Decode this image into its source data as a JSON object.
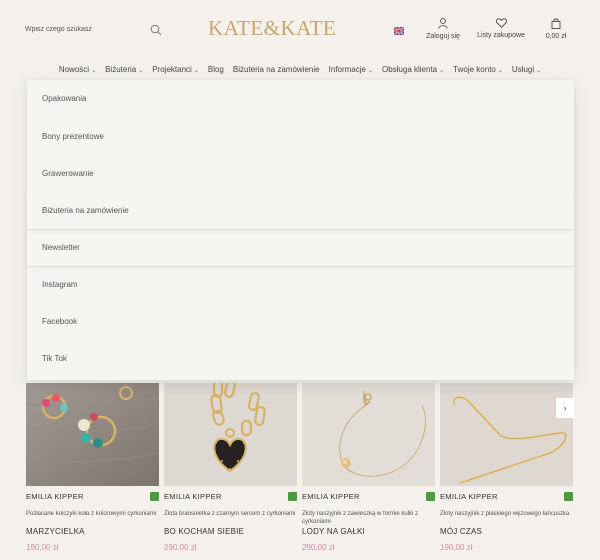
{
  "search": {
    "placeholder": "Wpisz czego szukasz"
  },
  "logo": {
    "text": "KATE&KATE"
  },
  "header": {
    "login_label": "Zaloguj się",
    "wishlist_label": "Listy zakupowe",
    "cart_label": "0,00 zł"
  },
  "nav": {
    "items": [
      {
        "label": "Nowości",
        "has_dropdown": true
      },
      {
        "label": "Biżuteria",
        "has_dropdown": true
      },
      {
        "label": "Projektanci",
        "has_dropdown": true
      },
      {
        "label": "Blog",
        "has_dropdown": false
      },
      {
        "label": "Biżuteria na zamówienie",
        "has_dropdown": false
      },
      {
        "label": "Informacje",
        "has_dropdown": true
      },
      {
        "label": "Obsługa klienta",
        "has_dropdown": true
      },
      {
        "label": "Twoje konto",
        "has_dropdown": true
      },
      {
        "label": "Usługi",
        "has_dropdown": true
      }
    ]
  },
  "dropdown": {
    "items": [
      "Opakowania",
      "Bony prezentowe",
      "Grawerowanie",
      "Biżuteria na zamówienie",
      "Newsletter",
      "Instagram",
      "Facebook",
      "Tik Tok"
    ]
  },
  "products": [
    {
      "brand": "EMILIA KIPPER",
      "desc": "Pozłacane kolczyki koła z kolorowymi cyrkoniami",
      "name": "MARZYCIELKA",
      "price": "190,00 zł"
    },
    {
      "brand": "EMILIA KIPPER",
      "desc": "Złota bransoletka z czarnym sercem z cyrkoniami",
      "name": "BO KOCHAM SIEBIE",
      "price": "290,00 zł"
    },
    {
      "brand": "EMILIA KIPPER",
      "desc": "Złoty naszyjnik z zawieszką w formie kulki z cyrkoniami",
      "name": "LODY NA GAŁKI",
      "price": "290,00 zł"
    },
    {
      "brand": "EMILIA KIPPER",
      "desc": "Złoty naszyjnik z płaskiego wężowego łańcuszka",
      "name": "MÓJ CZAS",
      "price": "190,00 zł"
    }
  ],
  "carousel": {
    "next_glyph": "›"
  },
  "colors": {
    "accent_logo": "#c8a56a",
    "price": "#d28aa5",
    "badge": "#4a9c3d",
    "background": "#f4f1ec"
  }
}
